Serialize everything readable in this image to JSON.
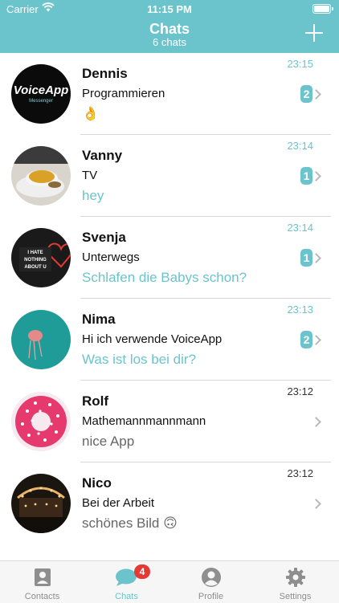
{
  "status": {
    "carrier": "Carrier",
    "time": "11:15 PM"
  },
  "header": {
    "title": "Chats",
    "subtitle": "6 chats"
  },
  "chats": [
    {
      "name": "Dennis",
      "line1": "Programmieren",
      "line2": "👌",
      "time": "23:15",
      "unread": "2"
    },
    {
      "name": "Vanny",
      "line1": "TV",
      "line2": "hey",
      "time": "23:14",
      "unread": "1"
    },
    {
      "name": "Svenja",
      "line1": "Unterwegs",
      "line2": "Schlafen die Babys schon?",
      "time": "23:14",
      "unread": "1"
    },
    {
      "name": "Nima",
      "line1": "Hi ich verwende VoiceApp",
      "line2": "Was ist los bei dir?",
      "time": "23:13",
      "unread": "2"
    },
    {
      "name": "Rolf",
      "line1": "Mathemannmannmann",
      "line2": "nice App",
      "time": "23:12",
      "unread": ""
    },
    {
      "name": "Nico",
      "line1": "Bei der Arbeit",
      "line2": "schönes Bild 🙃",
      "time": "23:12",
      "unread": ""
    }
  ],
  "avatars": {
    "dennis_logo": "VoiceApp",
    "dennis_logo_sub": "Messenger",
    "svenja_sign": [
      "I HATE",
      "NOTHING",
      "ABOUT U"
    ]
  },
  "tabs": {
    "contacts": "Contacts",
    "chats": "Chats",
    "chats_badge": "4",
    "profile": "Profile",
    "settings": "Settings"
  },
  "colors": {
    "accent": "#6bc4cc",
    "badge_red": "#e53935"
  }
}
